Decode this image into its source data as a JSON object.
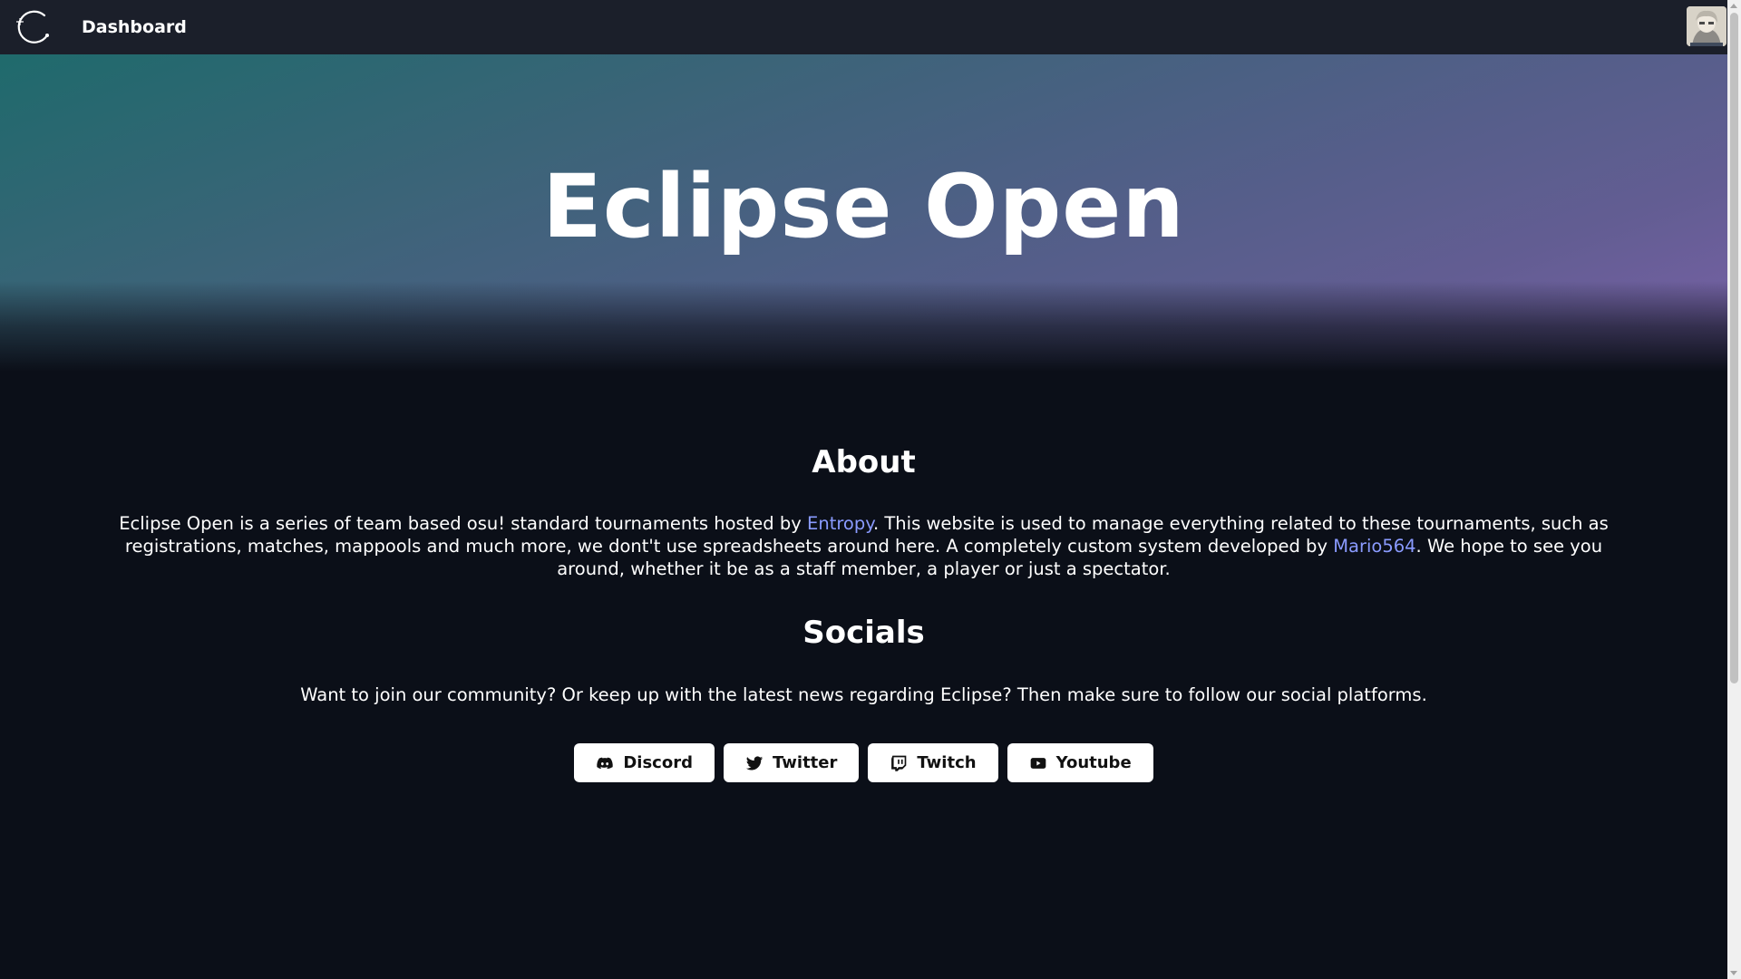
{
  "navbar": {
    "logo_icon": "eclipse-logo-icon",
    "dashboard_label": "Dashboard",
    "avatar_icon": "user-avatar-icon"
  },
  "hero": {
    "title": "Eclipse Open"
  },
  "about": {
    "heading": "About",
    "text_part1": "Eclipse Open is a series of team based osu! standard tournaments hosted by ",
    "link1": "Entropy",
    "text_part2": ". This website is used to manage everything related to these tournaments, such as registrations, matches, mappools and much more, we dont't use spreadsheets around here. A completely custom system developed by ",
    "link2": "Mario564",
    "text_part3": ". We hope to see you around, whether it be as a staff member, a player or just a spectator."
  },
  "socials": {
    "heading": "Socials",
    "text": "Want to join our community? Or keep up with the latest news regarding Eclipse? Then make sure to follow our social platforms.",
    "buttons": [
      {
        "label": "Discord",
        "icon": "discord-icon"
      },
      {
        "label": "Twitter",
        "icon": "twitter-icon"
      },
      {
        "label": "Twitch",
        "icon": "twitch-icon"
      },
      {
        "label": "Youtube",
        "icon": "youtube-icon"
      }
    ]
  },
  "colors": {
    "background": "#0b0f18",
    "navbar": "#1b1f2a",
    "link": "#8a9bff",
    "button_bg": "#ffffff"
  }
}
